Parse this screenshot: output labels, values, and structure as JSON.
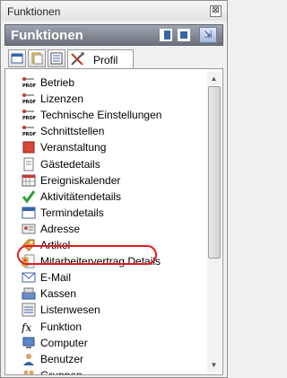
{
  "window": {
    "title": "Funktionen",
    "close_glyph": "⊠"
  },
  "header": {
    "title": "Funktionen",
    "pin_glyph": "⇲"
  },
  "tabs": {
    "active_label": "Profil"
  },
  "items": [
    {
      "label": "Betrieb",
      "icon": "profil-icon"
    },
    {
      "label": "Lizenzen",
      "icon": "profil-icon"
    },
    {
      "label": "Technische Einstellungen",
      "icon": "profil-icon"
    },
    {
      "label": "Schnittstellen",
      "icon": "profil-icon"
    },
    {
      "label": "Veranstaltung",
      "icon": "red-square-icon"
    },
    {
      "label": "Gästedetails",
      "icon": "document-icon"
    },
    {
      "label": "Ereigniskalender",
      "icon": "calendar-grid-icon"
    },
    {
      "label": "Aktivitätendetails",
      "icon": "checkmark-icon"
    },
    {
      "label": "Termindetails",
      "icon": "calendar-icon"
    },
    {
      "label": "Adresse",
      "icon": "address-card-icon"
    },
    {
      "label": "Artikel",
      "icon": "tag-icon"
    },
    {
      "label": "Mitarbeitervertrag Details",
      "icon": "contract-icon"
    },
    {
      "label": "E-Mail",
      "icon": "envelope-icon"
    },
    {
      "label": "Kassen",
      "icon": "cash-register-icon"
    },
    {
      "label": "Listenwesen",
      "icon": "list-icon"
    },
    {
      "label": "Funktion",
      "icon": "fx-icon"
    },
    {
      "label": "Computer",
      "icon": "computer-icon"
    },
    {
      "label": "Benutzer",
      "icon": "user-icon"
    },
    {
      "label": "Gruppen",
      "icon": "group-icon"
    }
  ],
  "highlighted_item": "Mitarbeitervertrag Details",
  "colors": {
    "header_bg": "#7b808a",
    "highlight_ring": "#e01b24",
    "icon_blue": "#3b63a6"
  }
}
